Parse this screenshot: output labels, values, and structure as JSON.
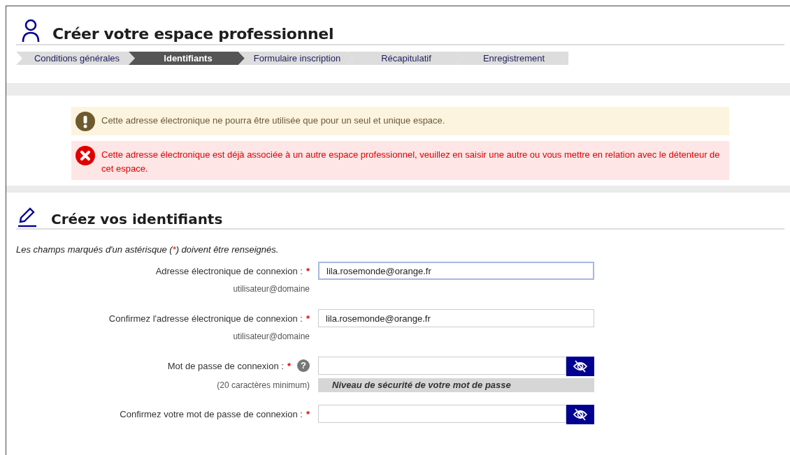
{
  "page_title": "Créer votre espace professionnel",
  "steps": [
    {
      "label": "Conditions générales",
      "selected": false
    },
    {
      "label": "Identifiants",
      "selected": true
    },
    {
      "label": "Formulaire inscription",
      "selected": false
    },
    {
      "label": "Récapitulatif",
      "selected": false
    },
    {
      "label": "Enregistrement",
      "selected": false
    }
  ],
  "alerts": [
    {
      "kind": "warning",
      "text": "Cette adresse électronique ne pourra être utilisée que pour un seul et unique espace."
    },
    {
      "kind": "error",
      "text": " Cette adresse électronique est déjà associée à un autre espace professionnel, veuillez en saisir une autre ou vous mettre en relation avec le détenteur de cet espace."
    }
  ],
  "section_title": "Créez vos identifiants",
  "required_note": {
    "before": "Les champs marqués d'un astérisque (",
    "mark": "*",
    "after": ") doivent être renseignés."
  },
  "fields": [
    {
      "kind": "text",
      "label": "Adresse électronique de connexion :",
      "required_mark": "*",
      "value": "lila.rosemonde@orange.fr",
      "hint": "utilisateur@domaine",
      "focused": true
    },
    {
      "kind": "text",
      "label": "Confirmez l'adresse électronique de connexion :",
      "required_mark": "*",
      "value": "lila.rosemonde@orange.fr",
      "hint": "utilisateur@domaine",
      "focused": false
    },
    {
      "kind": "password",
      "label": "Mot de passe de connexion :",
      "required_mark": "*",
      "help": "?",
      "hint": "(20 caractères minimum)",
      "strength": "Niveau de sécurité de votre mot de passe",
      "focused": false
    },
    {
      "kind": "password",
      "label": "Confirmez votre mot de passe de connexion :",
      "required_mark": "*",
      "focused": false
    }
  ]
}
